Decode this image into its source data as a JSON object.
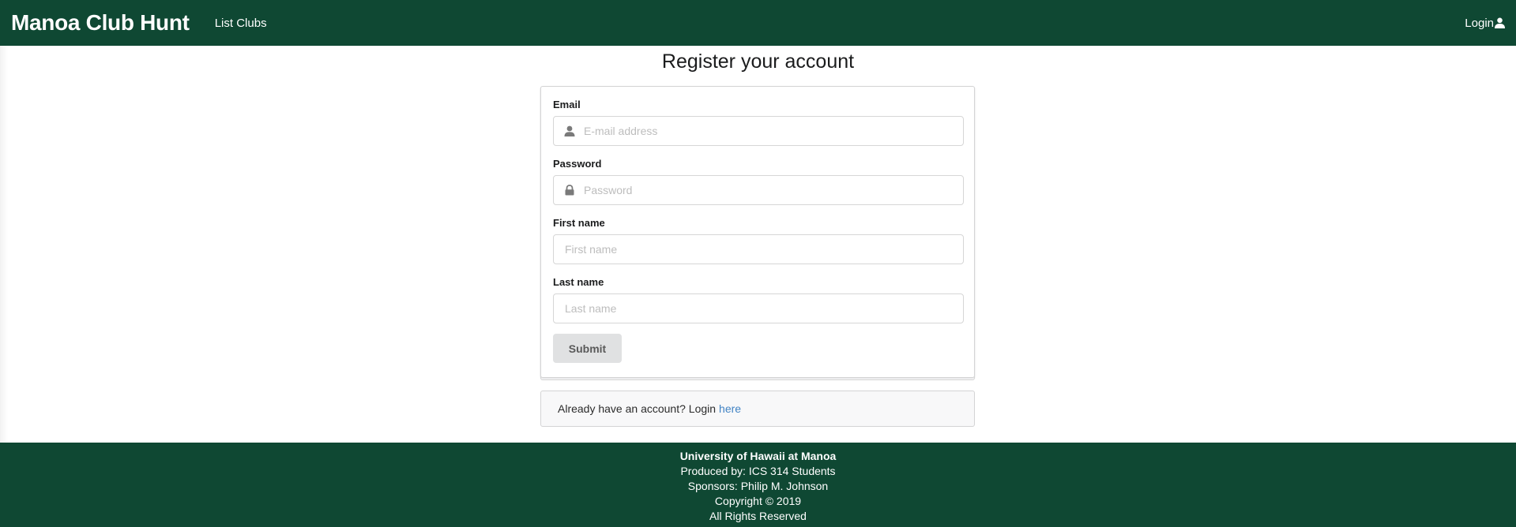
{
  "navbar": {
    "brand": "Manoa Club Hunt",
    "links": [
      "List Clubs"
    ],
    "login_label": "Login",
    "bg_color": "#0f4833"
  },
  "page": {
    "title": "Register your account"
  },
  "form": {
    "email": {
      "label": "Email",
      "placeholder": "E-mail address",
      "value": "",
      "icon": "user-icon"
    },
    "password": {
      "label": "Password",
      "placeholder": "Password",
      "value": "",
      "icon": "lock-icon"
    },
    "first_name": {
      "label": "First name",
      "placeholder": "First name",
      "value": ""
    },
    "last_name": {
      "label": "Last name",
      "placeholder": "Last name",
      "value": ""
    },
    "submit_label": "Submit"
  },
  "message": {
    "text": "Already have an account? Login",
    "link_text": "here",
    "link_color": "#4183c4"
  },
  "footer": {
    "lines": [
      "University of Hawaii at Manoa",
      "Produced by: ICS 314 Students",
      "Sponsors: Philip M. Johnson",
      "Copyright © 2019",
      "All Rights Reserved"
    ]
  }
}
